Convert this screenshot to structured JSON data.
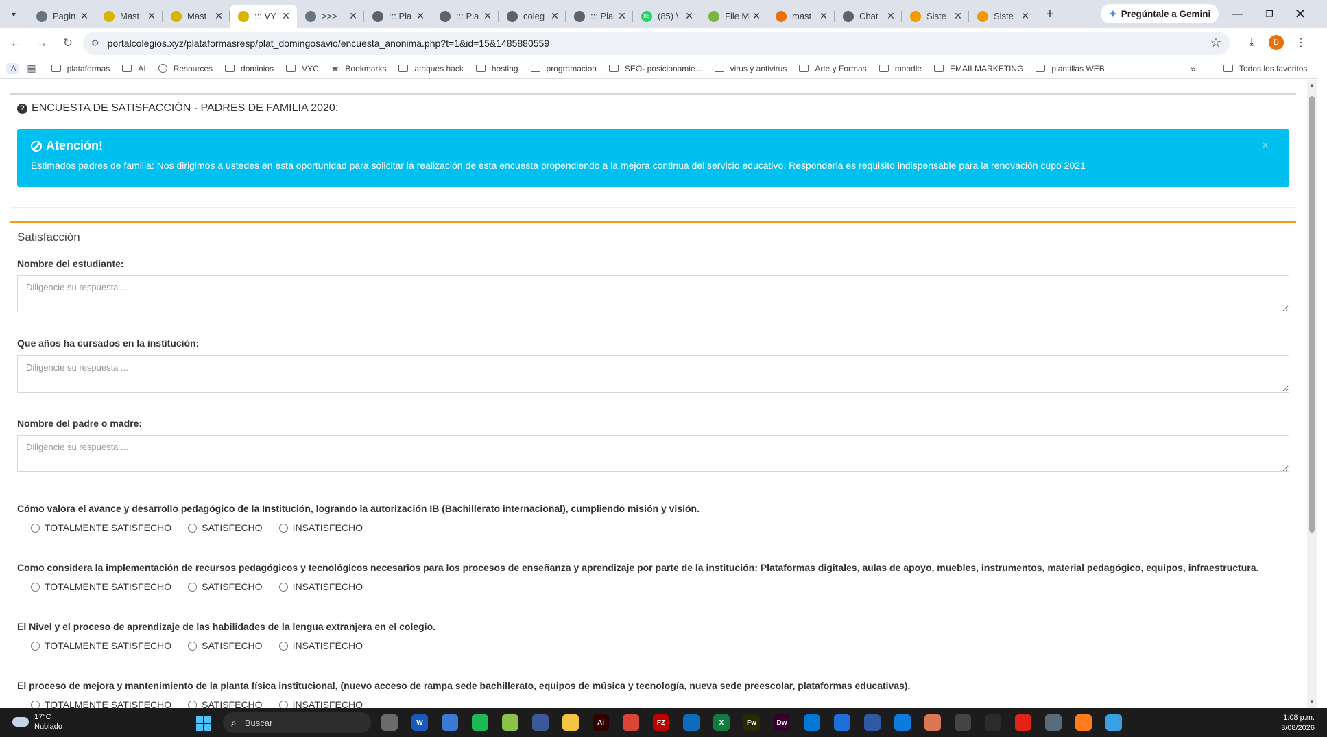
{
  "browser": {
    "tabs": [
      {
        "title": "Pagin",
        "favicon_color": "#6b7280",
        "active": false
      },
      {
        "title": "Mast",
        "favicon_color": "#d9b300",
        "active": false
      },
      {
        "title": "Mast",
        "favicon_color": "#d9b300",
        "active": false
      },
      {
        "title": "::: VY",
        "favicon_color": "#d9b300",
        "active": true
      },
      {
        "title": ">>>",
        "favicon_color": "#6b7280",
        "active": false
      },
      {
        "title": "::: Pla",
        "favicon_color": "#5f6368",
        "active": false
      },
      {
        "title": "::: Pla",
        "favicon_color": "#5f6368",
        "active": false
      },
      {
        "title": "coleg",
        "favicon_color": "#5f6368",
        "active": false
      },
      {
        "title": "::: Pla",
        "favicon_color": "#5f6368",
        "active": false
      },
      {
        "title": "(85) \\",
        "favicon_color": "#25d366",
        "favicon_text": "85",
        "active": false
      },
      {
        "title": "File M",
        "favicon_color": "#7cb342",
        "active": false
      },
      {
        "title": "mast",
        "favicon_color": "#e8710a",
        "active": false
      },
      {
        "title": "Chat",
        "favicon_color": "#5f6368",
        "active": false
      },
      {
        "title": "Siste",
        "favicon_color": "#f29900",
        "active": false
      },
      {
        "title": "Siste",
        "favicon_color": "#f29900",
        "active": false
      }
    ],
    "gemini_label": "Pregúntale a Gemini",
    "url": "portalcolegios.xyz/plataformasresp/plat_domingosavio/encuesta_anonima.php?t=1&id=15&1485880559",
    "profile_initial": "D",
    "bookmarks": [
      {
        "label": "plataformas",
        "icon": "folder-icon"
      },
      {
        "label": "AI",
        "icon": "folder-icon"
      },
      {
        "label": "Resources",
        "icon": "globe-icon"
      },
      {
        "label": "dominios",
        "icon": "folder-icon"
      },
      {
        "label": "VYC",
        "icon": "folder-icon"
      },
      {
        "label": "Bookmarks",
        "icon": "star-icon"
      },
      {
        "label": "ataques hack",
        "icon": "folder-icon"
      },
      {
        "label": "hosting",
        "icon": "folder-icon"
      },
      {
        "label": "programacion",
        "icon": "folder-icon"
      },
      {
        "label": "SEO- posicionamie...",
        "icon": "folder-icon"
      },
      {
        "label": "virus y antivirus",
        "icon": "folder-icon"
      },
      {
        "label": "Arte y Formas",
        "icon": "folder-icon"
      },
      {
        "label": "moodle",
        "icon": "folder-icon"
      },
      {
        "label": "EMAILMARKETING",
        "icon": "folder-icon"
      },
      {
        "label": "plantillas WEB",
        "icon": "folder-icon"
      }
    ],
    "ia_label": "IA",
    "all_bookmarks": "Todos los favoritos"
  },
  "page": {
    "survey_title": "ENCUESTA DE SATISFACCIÓN - PADRES DE FAMILIA 2020:",
    "alert": {
      "title": "Atención!",
      "text": "Estimados padres de familia: Nos dirigimos a ustedes en esta oportunidad para solicitar la realización de esta encuesta propendiendo a la mejora continua del servicio educativo. Responderla es requisito indispensable para la renovación cupo 2021",
      "close": "×"
    },
    "section_title": "Satisfacción",
    "placeholder": "Diligencie su respuesta ...",
    "text_questions": [
      "Nombre del estudiante:",
      "Que años ha cursados en la institución:",
      "Nombre del padre o madre:"
    ],
    "options": [
      "TOTALMENTE SATISFECHO",
      "SATISFECHO",
      "INSATISFECHO"
    ],
    "radio_questions": [
      "Cómo valora el avance y desarrollo pedagógico de la Institución, logrando la autorización IB (Bachillerato internacional), cumpliendo misión y visión.",
      "Como considera la implementación de recursos pedagógicos y tecnológicos necesarios para los procesos de enseñanza y aprendizaje por parte de la institución: Plataformas digitales, aulas de apoyo, muebles, instrumentos, material pedagógico, equipos, infraestructura.",
      "El Nivel y el proceso de aprendizaje de las habilidades de la lengua extranjera en el colegio.",
      "El proceso de mejora y mantenimiento de la planta física institucional, (nuevo acceso de rampa sede bachillerato, equipos de música y tecnología, nueva sede preescolar, plataformas educativas)."
    ]
  },
  "taskbar": {
    "weather_temp": "17°C",
    "weather_desc": "Nublado",
    "search_label": "Buscar",
    "time": "1:08 p.m.",
    "date": "3/08/2026",
    "apps": [
      {
        "name": "task-view-icon",
        "color": "#6b6b6b",
        "text": ""
      },
      {
        "name": "word-icon",
        "color": "#185abd",
        "text": "W"
      },
      {
        "name": "camera-icon",
        "color": "#3a7bd5",
        "text": ""
      },
      {
        "name": "spotify-icon",
        "color": "#1db954",
        "text": ""
      },
      {
        "name": "notepad-plus-icon",
        "color": "#8bc34a",
        "text": ""
      },
      {
        "name": "network-icon",
        "color": "#3b5998",
        "text": ""
      },
      {
        "name": "explorer-icon",
        "color": "#f4c542",
        "text": ""
      },
      {
        "name": "illustrator-icon",
        "color": "#330000",
        "text": "Ai"
      },
      {
        "name": "chrome-icon",
        "color": "#db4437",
        "text": ""
      },
      {
        "name": "filezilla-icon",
        "color": "#bf0000",
        "text": "FZ"
      },
      {
        "name": "outlook-icon",
        "color": "#0f6cbd",
        "text": ""
      },
      {
        "name": "excel-icon",
        "color": "#107c41",
        "text": "X"
      },
      {
        "name": "fireworks-icon",
        "color": "#2a2a00",
        "text": "Fw"
      },
      {
        "name": "dreamweaver-icon",
        "color": "#35002a",
        "text": "Dw"
      },
      {
        "name": "vscode-icon",
        "color": "#0078d4",
        "text": ""
      },
      {
        "name": "app-store-icon",
        "color": "#1e6fd9",
        "text": ""
      },
      {
        "name": "powershell-icon",
        "color": "#2d5aa0",
        "text": ""
      },
      {
        "name": "edge-icon",
        "color": "#0c7bdc",
        "text": ""
      },
      {
        "name": "claude-icon",
        "color": "#d97757",
        "text": ""
      },
      {
        "name": "box-icon",
        "color": "#444444",
        "text": ""
      },
      {
        "name": "terminal-icon",
        "color": "#2b2b2b",
        "text": ""
      },
      {
        "name": "acrobat-icon",
        "color": "#e2231a",
        "text": ""
      },
      {
        "name": "settings-icon",
        "color": "#5a6b7c",
        "text": ""
      },
      {
        "name": "sublime-icon",
        "color": "#ff7b1c",
        "text": ""
      },
      {
        "name": "notepad-icon",
        "color": "#3aa0e6",
        "text": ""
      }
    ]
  }
}
